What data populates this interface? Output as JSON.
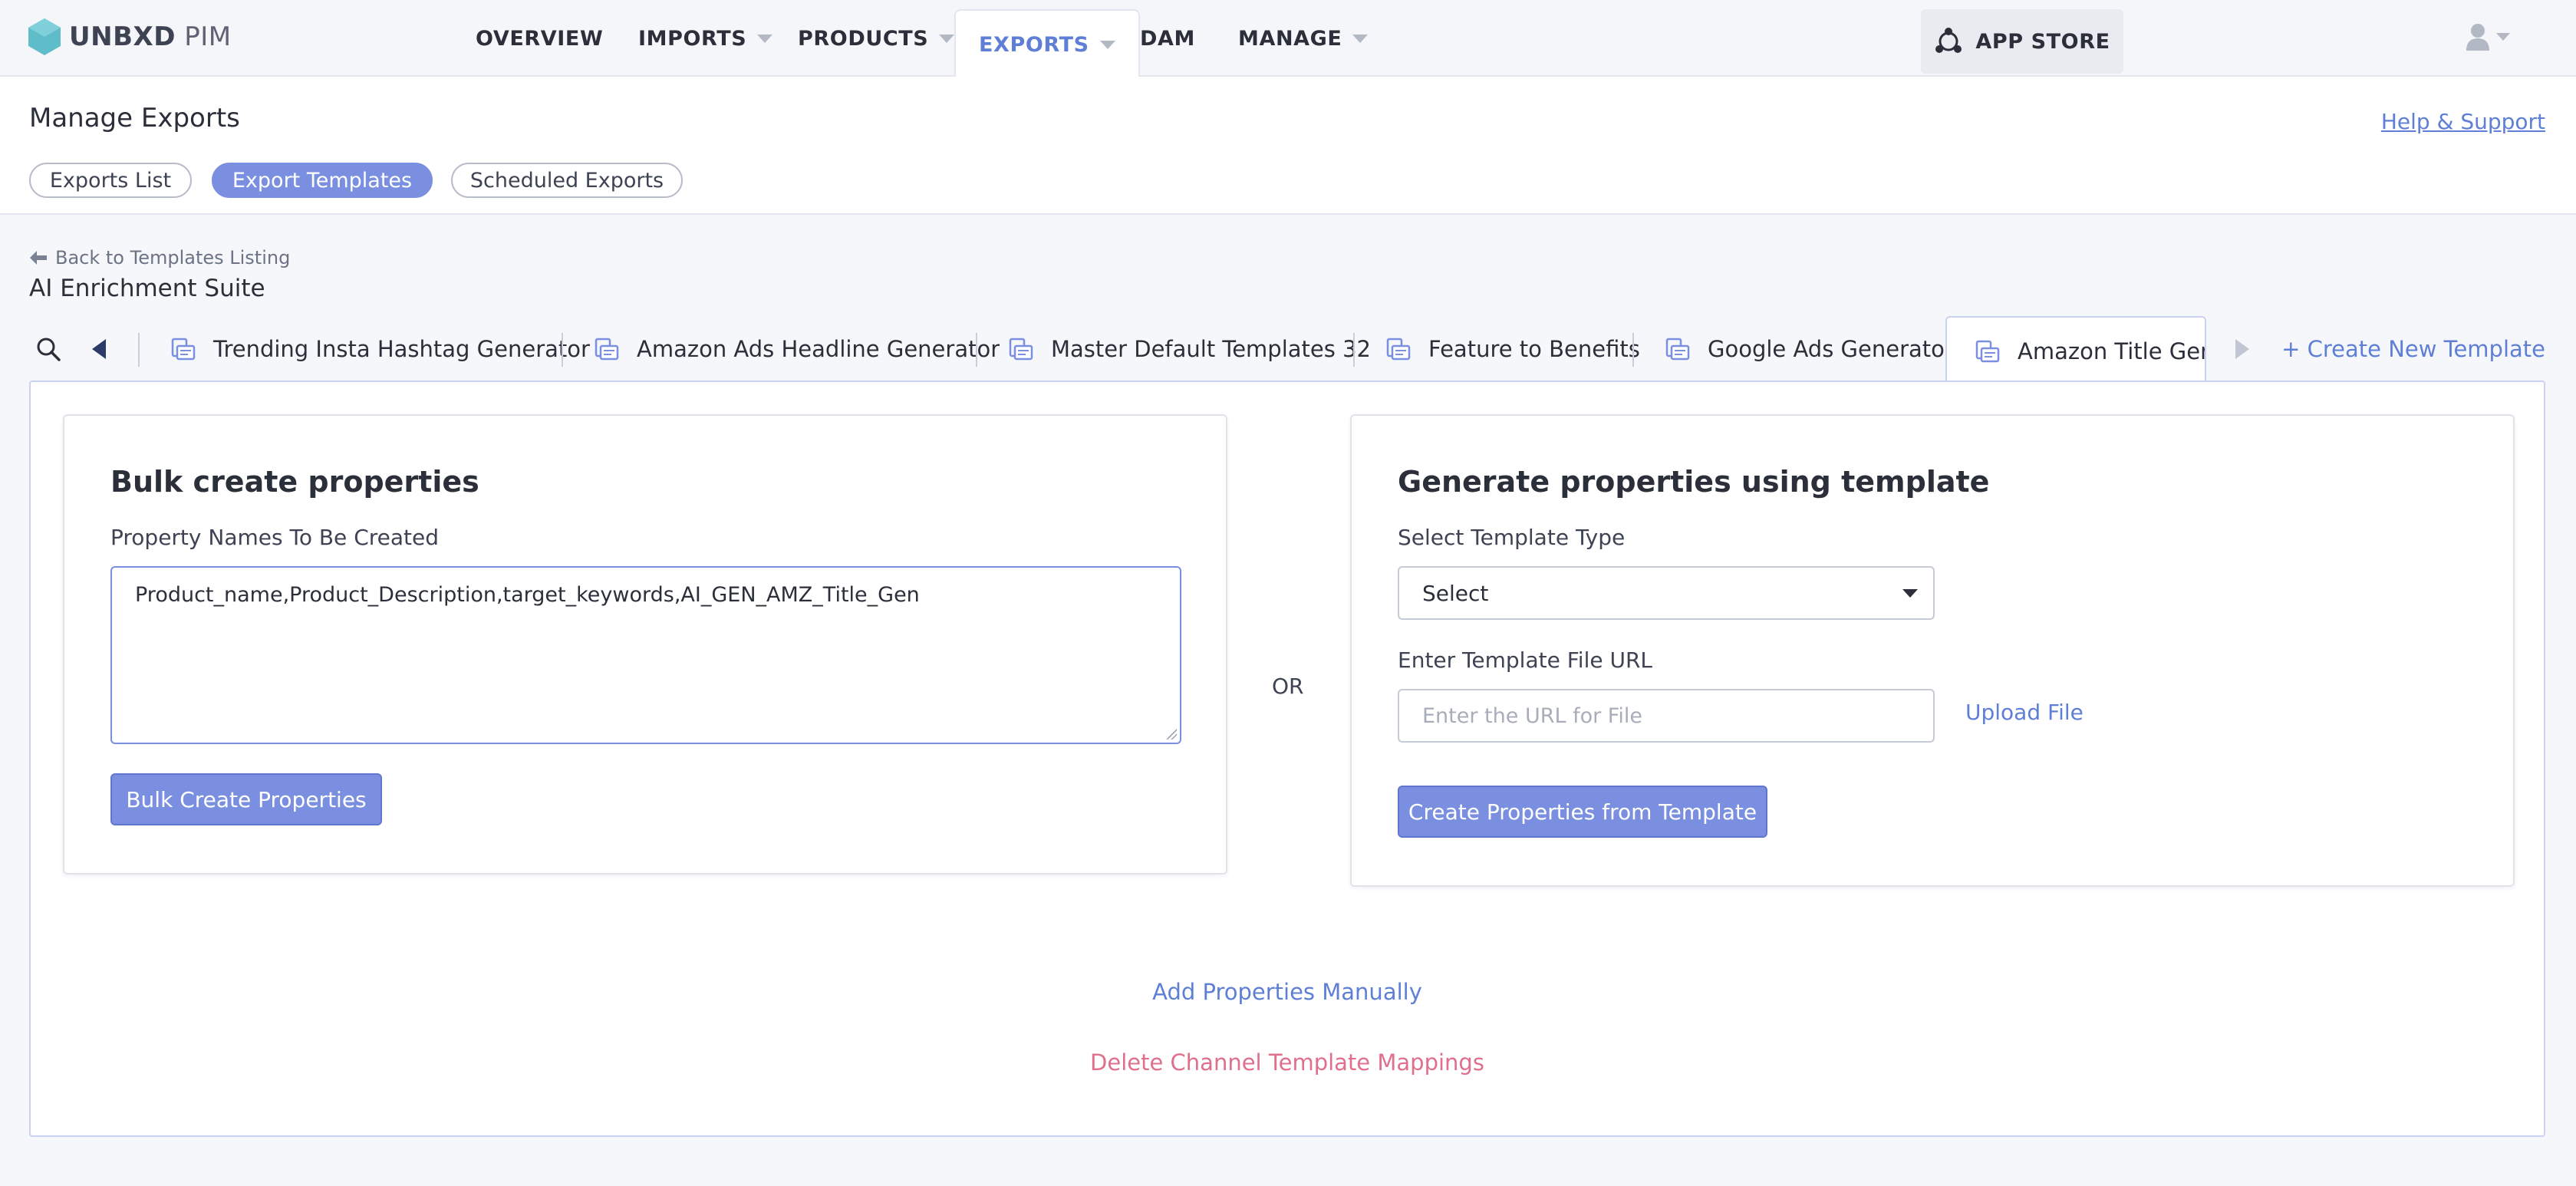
{
  "app": {
    "logo_main": "UNBXD",
    "logo_sub": "PIM",
    "brand_color": "#5fbcc9",
    "accent_color": "#7b8fe0"
  },
  "nav": {
    "items": [
      {
        "label": "OVERVIEW",
        "has_dropdown": false,
        "active": false
      },
      {
        "label": "IMPORTS",
        "has_dropdown": true,
        "active": false
      },
      {
        "label": "PRODUCTS",
        "has_dropdown": true,
        "active": false
      },
      {
        "label": "EXPORTS",
        "has_dropdown": true,
        "active": true
      },
      {
        "label": "DAM",
        "has_dropdown": false,
        "active": false
      },
      {
        "label": "MANAGE",
        "has_dropdown": true,
        "active": false
      }
    ],
    "app_store": "APP STORE",
    "user_icon": "user-icon"
  },
  "header": {
    "title": "Manage Exports",
    "help_link": "Help & Support",
    "subtabs": [
      {
        "label": "Exports List",
        "active": false
      },
      {
        "label": "Export Templates",
        "active": true
      },
      {
        "label": "Scheduled Exports",
        "active": false
      }
    ]
  },
  "breadcrumb": {
    "back_label": "Back to Templates Listing",
    "suite_title": "AI Enrichment Suite"
  },
  "template_tabs": {
    "tabs": [
      {
        "label": "Trending Insta Hashtag Generator",
        "active": false
      },
      {
        "label": "Amazon Ads Headline Generator",
        "active": false
      },
      {
        "label": "Master Default Templates 32",
        "active": false
      },
      {
        "label": "Feature to Benefits",
        "active": false
      },
      {
        "label": "Google Ads Generator",
        "active": false
      },
      {
        "label": "Amazon Title Generator",
        "active": true
      }
    ],
    "create_new": "+ Create New Template"
  },
  "bulk": {
    "title": "Bulk create properties",
    "field_label": "Property Names To Be Created",
    "field_value": "Product_name,Product_Description,target_keywords,AI_GEN_AMZ_Title_Gen",
    "button": "Bulk Create Properties"
  },
  "or_label": "OR",
  "generate": {
    "title": "Generate properties using template",
    "type_label": "Select Template Type",
    "type_value": "Select",
    "url_label": "Enter Template File URL",
    "url_placeholder": "Enter the URL for File",
    "upload_link": "Upload File",
    "button": "Create Properties from Template"
  },
  "footer_links": {
    "add_manual": "Add Properties Manually",
    "delete_mappings": "Delete Channel Template Mappings"
  }
}
